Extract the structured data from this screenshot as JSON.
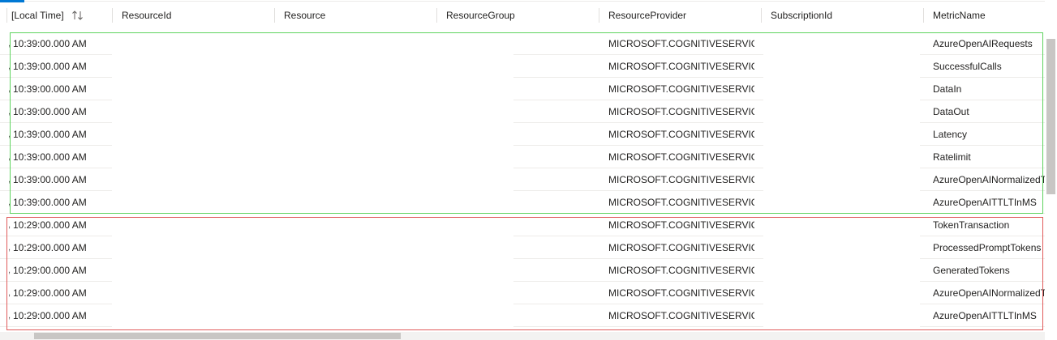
{
  "columns": {
    "time": "[Local Time]",
    "resource_id": "ResourceId",
    "resource": "Resource",
    "resource_group": "ResourceGroup",
    "resource_provider": "ResourceProvider",
    "subscription_id": "SubscriptionId",
    "metric_name": "MetricName"
  },
  "sort_icon": "sort-ascending-descending-icon",
  "row_prefix": ",",
  "rows": [
    {
      "time": "10:39:00.000 AM",
      "provider": "MICROSOFT.COGNITIVESERVIC...",
      "metric": "AzureOpenAIRequests"
    },
    {
      "time": "10:39:00.000 AM",
      "provider": "MICROSOFT.COGNITIVESERVIC...",
      "metric": "SuccessfulCalls"
    },
    {
      "time": "10:39:00.000 AM",
      "provider": "MICROSOFT.COGNITIVESERVIC...",
      "metric": "DataIn"
    },
    {
      "time": "10:39:00.000 AM",
      "provider": "MICROSOFT.COGNITIVESERVIC...",
      "metric": "DataOut"
    },
    {
      "time": "10:39:00.000 AM",
      "provider": "MICROSOFT.COGNITIVESERVIC...",
      "metric": "Latency"
    },
    {
      "time": "10:39:00.000 AM",
      "provider": "MICROSOFT.COGNITIVESERVIC...",
      "metric": "Ratelimit"
    },
    {
      "time": "10:39:00.000 AM",
      "provider": "MICROSOFT.COGNITIVESERVIC...",
      "metric": "AzureOpenAINormalizedT"
    },
    {
      "time": "10:39:00.000 AM",
      "provider": "MICROSOFT.COGNITIVESERVIC...",
      "metric": "AzureOpenAITTLTInMS"
    },
    {
      "time": "10:29:00.000 AM",
      "provider": "MICROSOFT.COGNITIVESERVIC...",
      "metric": "TokenTransaction"
    },
    {
      "time": "10:29:00.000 AM",
      "provider": "MICROSOFT.COGNITIVESERVIC...",
      "metric": "ProcessedPromptTokens"
    },
    {
      "time": "10:29:00.000 AM",
      "provider": "MICROSOFT.COGNITIVESERVIC...",
      "metric": "GeneratedTokens"
    },
    {
      "time": "10:29:00.000 AM",
      "provider": "MICROSOFT.COGNITIVESERVIC...",
      "metric": "AzureOpenAINormalizedT"
    },
    {
      "time": "10:29:00.000 AM",
      "provider": "MICROSOFT.COGNITIVESERVIC...",
      "metric": "AzureOpenAITTLTInMS"
    }
  ],
  "colors": {
    "green_highlight": "#5ed35e",
    "red_highlight": "#e05a5a",
    "accent": "#0078d4"
  }
}
